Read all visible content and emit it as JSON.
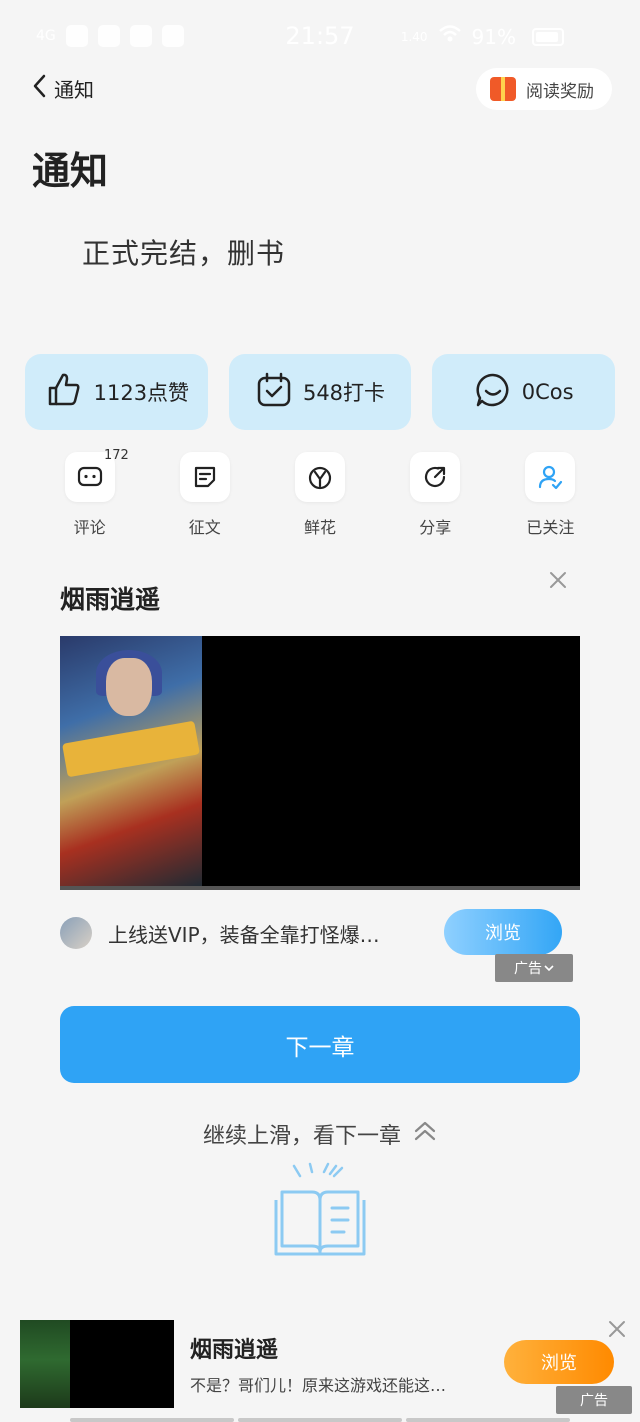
{
  "status_bar": {
    "signal": "4G",
    "time": "21:57",
    "speed": "1.40",
    "battery": "91%"
  },
  "nav": {
    "back_label": "通知",
    "reward_label": "阅读奖励"
  },
  "content": {
    "title": "通知",
    "body": "正式完结，删书"
  },
  "stats": [
    {
      "label": "1123点赞",
      "icon": "thumbs-up-icon"
    },
    {
      "label": "548打卡",
      "icon": "calendar-check-icon"
    },
    {
      "label": "0Cos",
      "icon": "chat-bubble-icon"
    }
  ],
  "actions": [
    {
      "label": "评论",
      "icon": "comment-icon",
      "count": "172"
    },
    {
      "label": "征文",
      "icon": "essay-icon"
    },
    {
      "label": "鲜花",
      "icon": "flower-icon"
    },
    {
      "label": "分享",
      "icon": "share-icon"
    },
    {
      "label": "已关注",
      "icon": "followed-user-icon"
    }
  ],
  "ad": {
    "title": "烟雨逍遥",
    "description": "上线送VIP，装备全靠打怪爆…",
    "button": "浏览",
    "tag": "广告"
  },
  "next_chapter": "下一章",
  "swipe_hint": "继续上滑，看下一章",
  "bottom_ad": {
    "title": "烟雨逍遥",
    "description": "不是？哥们儿！原来这游戏还能这…",
    "button": "浏览",
    "tag": "广告"
  },
  "colors": {
    "accent": "#2fa3f5",
    "stat_bg": "#d0ecfa",
    "orange": "#ff8a00"
  }
}
